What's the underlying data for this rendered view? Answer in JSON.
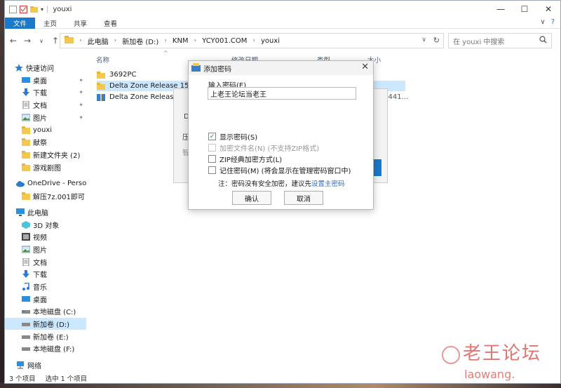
{
  "window": {
    "title": "youxi",
    "quick_access_sep": "|"
  },
  "window_controls": {
    "minimize": "—",
    "maximize": "☐",
    "close": "✕"
  },
  "ribbon": {
    "tabs": [
      "文件",
      "主页",
      "共享",
      "查看"
    ],
    "expand": "∨",
    "help": "?"
  },
  "nav": {
    "back": "←",
    "forward": "→",
    "recent": "∨",
    "up": "↑"
  },
  "address": {
    "crumbs": [
      "此电脑",
      "新加卷 (D:)",
      "KNM",
      "YCY001.COM",
      "youxi"
    ],
    "sep": "›",
    "dropdown": "∨",
    "refresh": "↻"
  },
  "search": {
    "placeholder": "在 youxi 中搜索"
  },
  "columns": {
    "name": "名称",
    "date": "修改日期",
    "type": "类型",
    "size": "大小"
  },
  "sidebar": {
    "items": [
      {
        "label": "快速访问",
        "icon": "star-icon"
      },
      {
        "label": "桌面",
        "icon": "desktop-icon",
        "pinned": true
      },
      {
        "label": "下载",
        "icon": "download-icon",
        "pinned": true
      },
      {
        "label": "文档",
        "icon": "document-icon",
        "pinned": true
      },
      {
        "label": "图片",
        "icon": "picture-icon",
        "pinned": true
      },
      {
        "label": "youxi",
        "icon": "folder-icon"
      },
      {
        "label": "献祭",
        "icon": "folder-icon"
      },
      {
        "label": "新建文件夹 (2)",
        "icon": "folder-icon"
      },
      {
        "label": "游戏剧图",
        "icon": "folder-icon"
      },
      {
        "label": "OneDrive - Persona",
        "icon": "cloud-icon"
      },
      {
        "label": "解压7z.001即可",
        "icon": "folder-icon"
      },
      {
        "label": "此电脑",
        "icon": "computer-icon"
      },
      {
        "label": "3D 对象",
        "icon": "cube-icon"
      },
      {
        "label": "视频",
        "icon": "video-icon"
      },
      {
        "label": "图片",
        "icon": "picture-icon"
      },
      {
        "label": "文档",
        "icon": "document-icon"
      },
      {
        "label": "下载",
        "icon": "download-icon"
      },
      {
        "label": "音乐",
        "icon": "music-icon"
      },
      {
        "label": "桌面",
        "icon": "desktop-icon"
      },
      {
        "label": "本地磁盘 (C:)",
        "icon": "drive-icon"
      },
      {
        "label": "新加卷 (D:)",
        "icon": "drive-icon",
        "selected": true
      },
      {
        "label": "新加卷 (E:)",
        "icon": "drive-icon"
      },
      {
        "label": "本地磁盘 (F:)",
        "icon": "drive-icon"
      },
      {
        "label": "网络",
        "icon": "network-icon"
      }
    ],
    "pin_glyph": "📌"
  },
  "files": [
    {
      "name": "3692PC",
      "icon": "folder-icon"
    },
    {
      "name": "Delta Zone Release 15.1 f",
      "icon": "folder-icon",
      "selected": true
    },
    {
      "name": "Delta Zone Release 1",
      "icon": "archive-icon"
    }
  ],
  "file_size_partial": "3,441...",
  "status": {
    "count": "3 个项目",
    "selection": "选中 1 个项目"
  },
  "bg_dialog": {
    "label_d": "D",
    "label_ya": "压",
    "label_zhi": "智"
  },
  "dialog": {
    "title": "添加密码",
    "close": "✕",
    "password_label": "输入密码(E)",
    "password_value": "上老王论坛当老王",
    "options": [
      {
        "label": "显示密码(S)",
        "checked": true,
        "disabled": false
      },
      {
        "label": "加密文件名(N) (不支持ZIP格式)",
        "checked": false,
        "disabled": true
      },
      {
        "label": "ZIP经典加密方式(L)",
        "checked": false,
        "disabled": false
      },
      {
        "label": "记住密码(M) (将会显示在管理密码窗口中)",
        "checked": false,
        "disabled": false
      }
    ],
    "check_glyph": "✓",
    "note_prefix": "注：密码没有安全加密，建议先",
    "note_link": "设置主密码",
    "ok": "确认",
    "cancel": "取消"
  },
  "watermark": {
    "line1": "老王论坛",
    "line2": "laowang."
  },
  "colors": {
    "accent": "#1979ca",
    "selection": "#cce8ff",
    "link": "#1c6fd1",
    "watermark": "#d9534f"
  }
}
